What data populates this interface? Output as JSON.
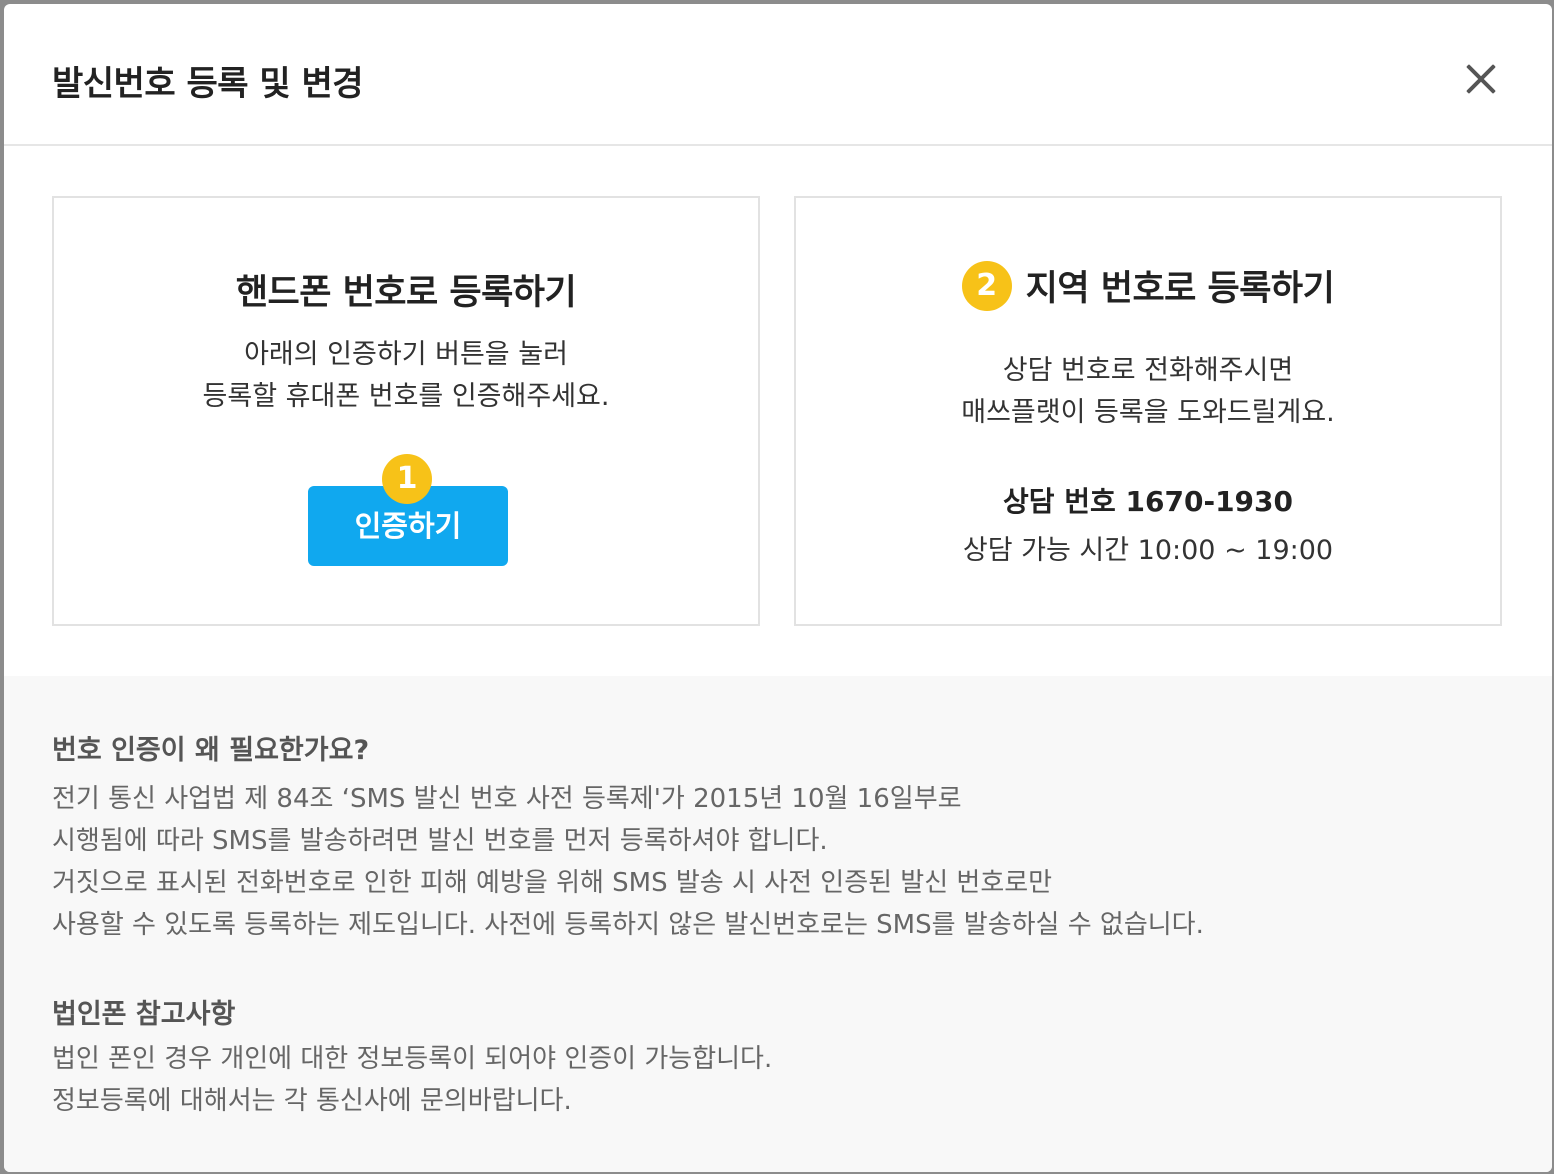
{
  "modal": {
    "title": "발신번호 등록 및 변경",
    "close_icon": "close-icon"
  },
  "left_card": {
    "title": "핸드폰 번호로 등록하기",
    "desc_line1": "아래의 인증하기 버튼을 눌러",
    "desc_line2": "등록할 휴대폰 번호를 인증해주세요.",
    "step_number": "1",
    "button_label": "인증하기"
  },
  "right_card": {
    "step_number": "2",
    "title": "지역 번호로 등록하기",
    "desc_line1": "상담 번호로 전화해주시면",
    "desc_line2": "매쓰플랫이 등록을 도와드릴게요.",
    "phone_line": "상담 번호 1670-1930",
    "hours_line": "상담 가능 시간 10:00 ~ 19:00"
  },
  "info": {
    "why_heading": "번호 인증이 왜 필요한가요?",
    "why_lines": [
      "전기 통신 사업법 제 84조 ‘SMS 발신 번호 사전 등록제'가 2015년 10월 16일부로",
      "시행됨에 따라 SMS를 발송하려면 발신 번호를 먼저 등록하셔야 합니다.",
      "거짓으로 표시된 전화번호로 인한 피해 예방을 위해 SMS 발송 시 사전 인증된 발신 번호로만",
      "사용할 수 있도록 등록하는 제도입니다. 사전에 등록하지 않은 발신번호로는 SMS를 발송하실 수 없습니다."
    ],
    "corp_heading": "법인폰 참고사항",
    "corp_lines": [
      "법인 폰인 경우 개인에 대한 정보등록이 되어야 인증이 가능합니다.",
      "정보등록에 대해서는 각 통신사에 문의바랍니다."
    ]
  },
  "colors": {
    "accent_button": "#10a8ef",
    "step_badge": "#f7c218",
    "info_background": "#f8f8f8"
  }
}
